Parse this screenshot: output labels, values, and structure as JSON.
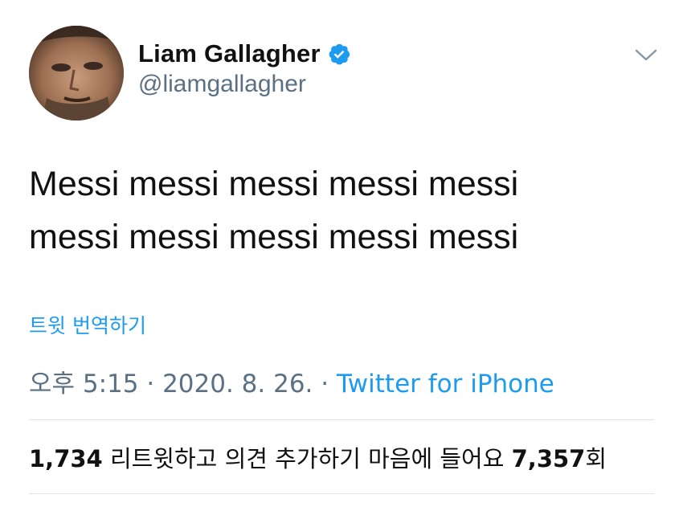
{
  "tweet": {
    "author": {
      "display_name": "Liam Gallagher",
      "handle": "@liamgallagher",
      "verified": true,
      "verified_color": "#1d9bf0"
    },
    "text_lines": [
      "Messi messi messi messi messi",
      "messi messi messi messi messi"
    ],
    "translate_label": "트윗 번역하기",
    "meta": {
      "time": "오후 5:15",
      "sep1": " · ",
      "date": "2020. 8. 26.",
      "sep2": " · ",
      "source": "Twitter for iPhone"
    },
    "stats": {
      "retweets_count": "1,734",
      "retweets_label": " 리트윗하고 의견 추가하기  ",
      "likes_label": "마음에 들어요 ",
      "likes_count": "7,357",
      "likes_suffix": "회"
    }
  },
  "icons": {
    "more": "chevron-down-icon",
    "verified": "verified-badge-icon"
  },
  "colors": {
    "link": "#1d9bf0",
    "secondary_text": "#5b7083",
    "divider": "#dde3e8"
  }
}
